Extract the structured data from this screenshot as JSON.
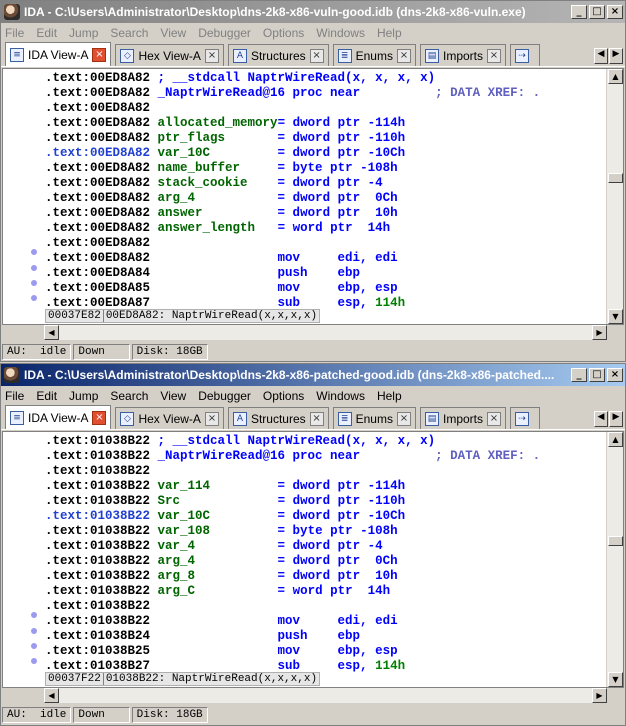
{
  "windows": [
    {
      "title": "IDA - C:\\Users\\Administrator\\Desktop\\dns-2k8-x86-vuln-good.idb (dns-2k8-x86-vuln.exe)",
      "controls": {
        "minimize": "_",
        "maximize": "□",
        "close": "×"
      },
      "menu": [
        "File",
        "Edit",
        "Jump",
        "Search",
        "View",
        "Debugger",
        "Options",
        "Windows",
        "Help"
      ],
      "tabs": [
        {
          "label": "IDA View-A",
          "icon": "ida-view-icon",
          "active": true
        },
        {
          "label": "Hex View-A",
          "icon": "hex-view-icon",
          "active": false
        },
        {
          "label": "Structures",
          "icon": "structures-icon",
          "active": false
        },
        {
          "label": "Enums",
          "icon": "enums-icon",
          "active": false
        },
        {
          "label": "Imports",
          "icon": "imports-icon",
          "active": false
        }
      ],
      "lines": [
        [
          [
            "c-addr",
            ".text:00ED8A82 "
          ],
          [
            "c-cmt",
            "; __stdcall NaptrWireRead(x, x, x, x)"
          ]
        ],
        [
          [
            "c-addr",
            ".text:00ED8A82 "
          ],
          [
            "c-cmt",
            "_NaptrWireRead@16 proc near"
          ],
          [
            "c-xref",
            "          ; DATA XREF: ."
          ]
        ],
        [
          [
            "c-addr",
            ".text:00ED8A82"
          ]
        ],
        [
          [
            "c-addr",
            ".text:00ED8A82 "
          ],
          [
            "c-name",
            "allocated_memory"
          ],
          [
            "c-cmt",
            "= dword ptr -114h"
          ]
        ],
        [
          [
            "c-addr",
            ".text:00ED8A82 "
          ],
          [
            "c-name",
            "ptr_flags"
          ],
          [
            "c-cmt",
            "       = dword ptr -110h"
          ]
        ],
        [
          [
            "c-addr-hl",
            ".text:00ED8A82 "
          ],
          [
            "c-name",
            "var_10C"
          ],
          [
            "c-cmt",
            "         = dword ptr -10Ch"
          ]
        ],
        [
          [
            "c-addr",
            ".text:00ED8A82 "
          ],
          [
            "c-name",
            "name_buffer"
          ],
          [
            "c-cmt",
            "     = byte ptr -108h"
          ]
        ],
        [
          [
            "c-addr",
            ".text:00ED8A82 "
          ],
          [
            "c-name",
            "stack_cookie"
          ],
          [
            "c-cmt",
            "    = dword ptr -4"
          ]
        ],
        [
          [
            "c-addr",
            ".text:00ED8A82 "
          ],
          [
            "c-name",
            "arg_4"
          ],
          [
            "c-cmt",
            "           = dword ptr  0Ch"
          ]
        ],
        [
          [
            "c-addr",
            ".text:00ED8A82 "
          ],
          [
            "c-name",
            "answer"
          ],
          [
            "c-cmt",
            "          = dword ptr  10h"
          ]
        ],
        [
          [
            "c-addr",
            ".text:00ED8A82 "
          ],
          [
            "c-name",
            "answer_length"
          ],
          [
            "c-cmt",
            "   = word ptr  14h"
          ]
        ],
        [
          [
            "c-addr",
            ".text:00ED8A82"
          ]
        ],
        [
          [
            "c-addr",
            ".text:00ED8A82                 "
          ],
          [
            "c-cmt",
            "mov     edi, edi"
          ]
        ],
        [
          [
            "c-addr",
            ".text:00ED8A84                 "
          ],
          [
            "c-cmt",
            "push    ebp"
          ]
        ],
        [
          [
            "c-addr",
            ".text:00ED8A85                 "
          ],
          [
            "c-cmt",
            "mov     ebp, esp"
          ]
        ],
        [
          [
            "c-addr",
            ".text:00ED8A87                 "
          ],
          [
            "c-cmt",
            "sub     esp, "
          ],
          [
            "c-num",
            "114h"
          ]
        ]
      ],
      "status_offset": "00037E82",
      "status_location": "00ED8A82: NaptrWireRead(x,x,x,x)",
      "bottom": [
        "AU:  idle",
        "Down   ",
        "Disk: 18GB"
      ]
    },
    {
      "title": "IDA - C:\\Users\\Administrator\\Desktop\\dns-2k8-x86-patched-good.idb (dns-2k8-x86-patched....",
      "controls": {
        "minimize": "_",
        "maximize": "□",
        "close": "×"
      },
      "menu": [
        "File",
        "Edit",
        "Jump",
        "Search",
        "View",
        "Debugger",
        "Options",
        "Windows",
        "Help"
      ],
      "tabs": [
        {
          "label": "IDA View-A",
          "icon": "ida-view-icon",
          "active": true
        },
        {
          "label": "Hex View-A",
          "icon": "hex-view-icon",
          "active": false
        },
        {
          "label": "Structures",
          "icon": "structures-icon",
          "active": false
        },
        {
          "label": "Enums",
          "icon": "enums-icon",
          "active": false
        },
        {
          "label": "Imports",
          "icon": "imports-icon",
          "active": false
        }
      ],
      "lines": [
        [
          [
            "c-addr",
            ".text:01038B22 "
          ],
          [
            "c-cmt",
            "; __stdcall NaptrWireRead(x, x, x, x)"
          ]
        ],
        [
          [
            "c-addr",
            ".text:01038B22 "
          ],
          [
            "c-cmt",
            "_NaptrWireRead@16 proc near"
          ],
          [
            "c-xref",
            "          ; DATA XREF: ."
          ]
        ],
        [
          [
            "c-addr",
            ".text:01038B22"
          ]
        ],
        [
          [
            "c-addr",
            ".text:01038B22 "
          ],
          [
            "c-name",
            "var_114"
          ],
          [
            "c-cmt",
            "         = dword ptr -114h"
          ]
        ],
        [
          [
            "c-addr",
            ".text:01038B22 "
          ],
          [
            "c-name",
            "Src"
          ],
          [
            "c-cmt",
            "             = dword ptr -110h"
          ]
        ],
        [
          [
            "c-addr-hl",
            ".text:01038B22 "
          ],
          [
            "c-name",
            "var_10C"
          ],
          [
            "c-cmt",
            "         = dword ptr -10Ch"
          ]
        ],
        [
          [
            "c-addr",
            ".text:01038B22 "
          ],
          [
            "c-name",
            "var_108"
          ],
          [
            "c-cmt",
            "         = byte ptr -108h"
          ]
        ],
        [
          [
            "c-addr",
            ".text:01038B22 "
          ],
          [
            "c-name",
            "var_4"
          ],
          [
            "c-cmt",
            "           = dword ptr -4"
          ]
        ],
        [
          [
            "c-addr",
            ".text:01038B22 "
          ],
          [
            "c-name",
            "arg_4"
          ],
          [
            "c-cmt",
            "           = dword ptr  0Ch"
          ]
        ],
        [
          [
            "c-addr",
            ".text:01038B22 "
          ],
          [
            "c-name",
            "arg_8"
          ],
          [
            "c-cmt",
            "           = dword ptr  10h"
          ]
        ],
        [
          [
            "c-addr",
            ".text:01038B22 "
          ],
          [
            "c-name",
            "arg_C"
          ],
          [
            "c-cmt",
            "           = word ptr  14h"
          ]
        ],
        [
          [
            "c-addr",
            ".text:01038B22"
          ]
        ],
        [
          [
            "c-addr",
            ".text:01038B22                 "
          ],
          [
            "c-cmt",
            "mov     edi, edi"
          ]
        ],
        [
          [
            "c-addr",
            ".text:01038B24                 "
          ],
          [
            "c-cmt",
            "push    ebp"
          ]
        ],
        [
          [
            "c-addr",
            ".text:01038B25                 "
          ],
          [
            "c-cmt",
            "mov     ebp, esp"
          ]
        ],
        [
          [
            "c-addr",
            ".text:01038B27                 "
          ],
          [
            "c-cmt",
            "sub     esp, "
          ],
          [
            "c-num",
            "114h"
          ]
        ]
      ],
      "status_offset": "00037F22",
      "status_location": "01038B22: NaptrWireRead(x,x,x,x)",
      "bottom": [
        "AU:  idle",
        "Down   ",
        "Disk: 18GB"
      ]
    }
  ]
}
